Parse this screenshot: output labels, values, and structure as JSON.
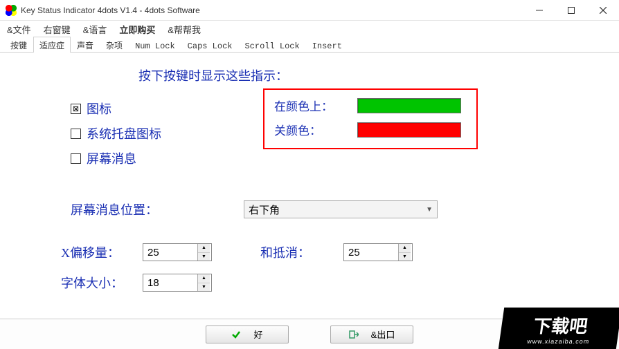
{
  "window": {
    "title": "Key Status Indicator 4dots V1.4 - 4dots Software"
  },
  "menu": {
    "file": "&文件",
    "rightWindow": "右窗键",
    "language": "&语言",
    "buyNow": "立即购买",
    "help": "&帮帮我"
  },
  "tabs": {
    "t0": "按键",
    "t1": "适应症",
    "t2": "声音",
    "t3": "杂项",
    "t4": "Num Lock",
    "t5": "Caps Lock",
    "t6": "Scroll Lock",
    "t7": "Insert"
  },
  "heading": "按下按键时显示这些指示：",
  "checks": {
    "icon": "图标",
    "tray": "系统托盘图标",
    "osd": "屏幕消息"
  },
  "colors": {
    "onLabel": "在颜色上：",
    "offLabel": "关颜色：",
    "onValue": "#00c400",
    "offValue": "#ff0000"
  },
  "position": {
    "label": "屏幕消息位置：",
    "value": "右下角"
  },
  "offsets": {
    "xLabel": "X偏移量：",
    "xValue": "25",
    "yLabel": "和抵消：",
    "yValue": "25"
  },
  "font": {
    "label": "字体大小：",
    "value": "18"
  },
  "buttons": {
    "ok": "好",
    "exit": "&出口"
  },
  "watermark": {
    "main": "下载吧",
    "sub": "www.xiazaiba.com"
  }
}
